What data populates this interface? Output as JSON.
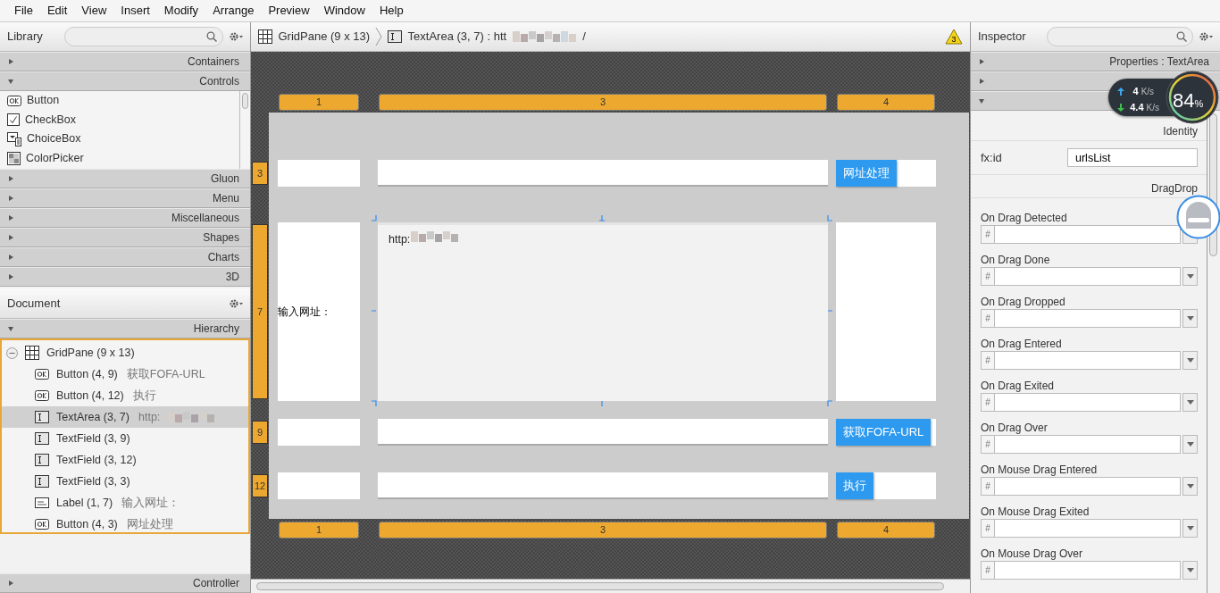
{
  "menu": [
    "File",
    "Edit",
    "View",
    "Insert",
    "Modify",
    "Arrange",
    "Preview",
    "Window",
    "Help"
  ],
  "library": {
    "title": "Library",
    "sections": [
      {
        "label": "Containers",
        "expanded": false
      },
      {
        "label": "Controls",
        "expanded": true,
        "items": [
          {
            "label": "Button",
            "kind": "button"
          },
          {
            "label": "CheckBox",
            "kind": "checkbox"
          },
          {
            "label": "ChoiceBox",
            "kind": "choicebox"
          },
          {
            "label": "ColorPicker",
            "kind": "colorpicker"
          }
        ]
      },
      {
        "label": "Gluon",
        "expanded": false
      },
      {
        "label": "Menu",
        "expanded": false
      },
      {
        "label": "Miscellaneous",
        "expanded": false
      },
      {
        "label": "Shapes",
        "expanded": false
      },
      {
        "label": "Charts",
        "expanded": false
      },
      {
        "label": "3D",
        "expanded": false
      }
    ]
  },
  "document": {
    "title": "Document",
    "section": {
      "label": "Hierarchy",
      "expanded": true
    },
    "tree": {
      "label": "GridPane (9 x 13)",
      "kind": "grid",
      "expanded": true,
      "children": [
        {
          "label": "Button (4, 9)",
          "detail": "获取FOFA-URL",
          "kind": "button",
          "selected": false
        },
        {
          "label": "Button (4, 12)",
          "detail": "执行",
          "kind": "button",
          "selected": false
        },
        {
          "label": "TextArea (3, 7)",
          "detail": "http:",
          "redacted": true,
          "kind": "text",
          "selected": true
        },
        {
          "label": "TextField (3, 9)",
          "kind": "text",
          "selected": false
        },
        {
          "label": "TextField (3, 12)",
          "kind": "text",
          "selected": false
        },
        {
          "label": "TextField (3, 3)",
          "kind": "text",
          "selected": false
        },
        {
          "label": "Label (1, 7)",
          "detail": "输入网址：",
          "kind": "label",
          "selected": false
        },
        {
          "label": "Button (4, 3)",
          "detail": "网址处理",
          "kind": "button",
          "selected": false
        }
      ]
    },
    "controller": {
      "label": "Controller",
      "expanded": false
    }
  },
  "breadcrumb": [
    {
      "label": "GridPane (9 x 13)",
      "kind": "grid"
    },
    {
      "label": "TextArea (3, 7) : htt",
      "kind": "text",
      "redacted": true,
      "tail": "/"
    }
  ],
  "warning_count": "3",
  "canvas": {
    "column_headers": [
      "1",
      "3",
      "4"
    ],
    "column_footers": [
      "1",
      "3",
      "4"
    ],
    "rows": [
      {
        "header": "3",
        "field": {
          "kind": "textfield"
        },
        "button": "网址处理"
      },
      {
        "header": "7",
        "label": "输入网址：",
        "field": {
          "kind": "textarea",
          "value": "http:",
          "redacted": true,
          "selected": true
        }
      },
      {
        "header": "9",
        "field": {
          "kind": "textfield"
        },
        "button": "获取FOFA-URL"
      },
      {
        "header": "12",
        "field": {
          "kind": "textfield"
        },
        "button": "执行"
      }
    ]
  },
  "inspector": {
    "title": "Inspector",
    "sections": [
      {
        "label": "Properties : TextArea",
        "expanded": false
      },
      {
        "expanded": false
      },
      {
        "expanded": true
      }
    ],
    "identity": {
      "title": "Identity",
      "field_label": "fx:id",
      "value": "urlsList"
    },
    "dragdrop": {
      "title": "DragDrop",
      "handlers": [
        "On Drag Detected",
        "On Drag Done",
        "On Drag Dropped",
        "On Drag Entered",
        "On Drag Exited",
        "On Drag Over",
        "On Mouse Drag Entered",
        "On Mouse Drag Exited",
        "On Mouse Drag Over"
      ],
      "hash": "#"
    }
  },
  "net_widget": {
    "upload": "4",
    "upload_unit": "K/s",
    "download": "4.4",
    "download_unit": "K/s",
    "percent": "84",
    "percent_unit": "%"
  }
}
